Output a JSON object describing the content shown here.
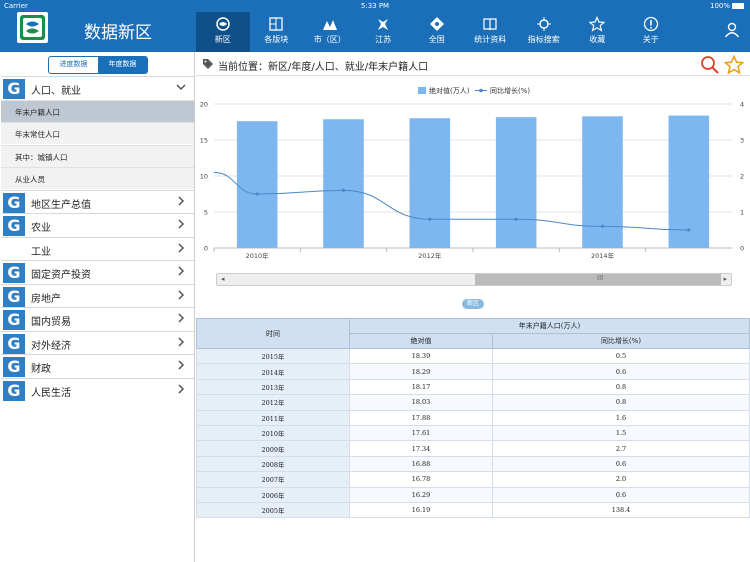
{
  "status": {
    "carrier": "Carrier",
    "time": "5:33 PM",
    "battery": "100%"
  },
  "app": {
    "title": "数据新区"
  },
  "nav": [
    {
      "label": "新区",
      "icon": "newzone-icon",
      "active": true
    },
    {
      "label": "各版块",
      "icon": "sections-icon"
    },
    {
      "label": "市（区）",
      "icon": "city-icon"
    },
    {
      "label": "江苏",
      "icon": "jiangsu-icon"
    },
    {
      "label": "全国",
      "icon": "national-icon"
    },
    {
      "label": "统计资料",
      "icon": "book-icon"
    },
    {
      "label": "指标搜索",
      "icon": "indicator-search-icon"
    },
    {
      "label": "收藏",
      "icon": "star-icon"
    },
    {
      "label": "关于",
      "icon": "info-icon"
    }
  ],
  "sidebar": {
    "segments": [
      "进度数据",
      "年度数据"
    ],
    "active_segment": "年度数据",
    "expanded_category": {
      "label": "人口、就业",
      "items": [
        "年末户籍人口",
        "年末常住人口",
        "其中：城镇人口",
        "从业人员"
      ],
      "selected": "年末户籍人口"
    },
    "categories": [
      "地区生产总值",
      "农业",
      "工业",
      "固定资产投资",
      "房地产",
      "国内贸易",
      "对外经济",
      "财政",
      "人民生活"
    ],
    "badge_letter": "G"
  },
  "breadcrumb": {
    "prefix": "当前位置：",
    "path": "新区/年度/人口、就业/年末户籍人口"
  },
  "chart_data": {
    "type": "bar",
    "legend": [
      "绝对值(万人)",
      "同比增长(%)"
    ],
    "x": [
      "2010年",
      "2011年",
      "2012年",
      "2013年",
      "2014年",
      "2015年"
    ],
    "x_tick_labels": [
      "2010年",
      "2012年",
      "2014年"
    ],
    "series": [
      {
        "name": "绝对值(万人)",
        "type": "bar",
        "axis": "left",
        "values": [
          17.61,
          17.88,
          18.03,
          18.17,
          18.29,
          18.39
        ]
      },
      {
        "name": "同比增长(%)",
        "type": "line",
        "axis": "right",
        "values": [
          1.5,
          1.6,
          0.8,
          0.8,
          0.6,
          0.5
        ],
        "start": 2.1
      }
    ],
    "ylim_left": [
      0,
      20
    ],
    "yticks_left": [
      0,
      5,
      10,
      15,
      20
    ],
    "ylim_right": [
      0,
      4
    ],
    "yticks_right": [
      0,
      1,
      2,
      3,
      4
    ],
    "colors": {
      "bar": "#7eb6f0",
      "line": "#4a88c8"
    }
  },
  "scroller": {
    "grip": "III",
    "left_arrow": "◂",
    "right_arrow": "▸"
  },
  "pill_label": "新区",
  "table": {
    "col_time": "时间",
    "group_header": "年末户籍人口(万人)",
    "col_abs": "绝对值",
    "col_growth": "同比增长(%)",
    "rows": [
      [
        "2015年",
        "18.39",
        "0.5"
      ],
      [
        "2014年",
        "18.29",
        "0.6"
      ],
      [
        "2013年",
        "18.17",
        "0.8"
      ],
      [
        "2012年",
        "18.03",
        "0.8"
      ],
      [
        "2011年",
        "17.88",
        "1.6"
      ],
      [
        "2010年",
        "17.61",
        "1.5"
      ],
      [
        "2009年",
        "17.34",
        "2.7"
      ],
      [
        "2008年",
        "16.88",
        "0.6"
      ],
      [
        "2007年",
        "16.78",
        "2.0"
      ],
      [
        "2006年",
        "16.29",
        "0.6"
      ],
      [
        "2005年",
        "16.19",
        "138.4"
      ]
    ]
  }
}
